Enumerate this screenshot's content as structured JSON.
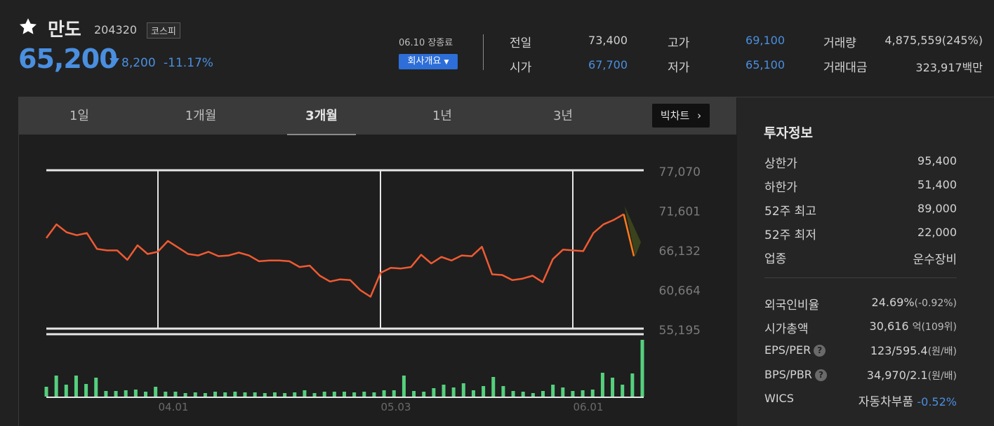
{
  "stock": {
    "name": "만도",
    "code": "204320",
    "market": "코스피",
    "price": "65,200",
    "change": "8,200",
    "change_pct": "-11.17%",
    "closed_label": "06.10 장종료",
    "company_button": "회사개요"
  },
  "summary": {
    "prev_label": "전일",
    "prev": "73,400",
    "open_label": "시가",
    "open": "67,700",
    "high_label": "고가",
    "high": "69,100",
    "low_label": "저가",
    "low": "65,100",
    "volume_label": "거래량",
    "volume": "4,875,559(245%)",
    "amount_label": "거래대금",
    "amount": "323,917백만"
  },
  "tabs": [
    "1일",
    "1개월",
    "3개월",
    "1년",
    "3년"
  ],
  "active_tab": "3개월",
  "big_chart_label": "빅차트",
  "chart_data": {
    "type": "line",
    "y_ticks": [
      "77,070",
      "71,601",
      "66,132",
      "60,664",
      "55,195"
    ],
    "x_ticks": [
      "04.01",
      "05.03",
      "06.01"
    ],
    "ylim": [
      55195,
      77070
    ],
    "series": [
      {
        "values": [
          67700,
          69600,
          68500,
          68100,
          68400,
          66200,
          66000,
          66000,
          64700,
          66700,
          65500,
          65800,
          67300,
          66400,
          65500,
          65300,
          65800,
          65200,
          65300,
          65700,
          65300,
          64500,
          64600,
          64600,
          64500,
          63700,
          63900,
          62500,
          61700,
          62000,
          61900,
          60500,
          59600,
          62900,
          63600,
          63500,
          63700,
          65400,
          64200,
          65100,
          64600,
          65300,
          65200,
          66500,
          62700,
          62600,
          61900,
          62100,
          62500,
          61600,
          64800,
          66100,
          66000,
          65900,
          68400,
          69600,
          70200,
          71000,
          65200
        ],
        "volumes": [
          14,
          30,
          17,
          30,
          18,
          27,
          8,
          8,
          9,
          10,
          7,
          14,
          7,
          7,
          5,
          6,
          5,
          7,
          6,
          7,
          6,
          6,
          5,
          6,
          5,
          6,
          9,
          5,
          7,
          7,
          7,
          6,
          7,
          6,
          9,
          9,
          30,
          8,
          7,
          12,
          17,
          13,
          19,
          9,
          15,
          28,
          15,
          8,
          7,
          5,
          8,
          17,
          13,
          8,
          9,
          10,
          34,
          27,
          17,
          33,
          81
        ],
        "color": "#f05a32"
      }
    ]
  },
  "invest": {
    "title": "투자정보",
    "rows": [
      {
        "label": "상한가",
        "value": "95,400"
      },
      {
        "label": "하한가",
        "value": "51,400"
      },
      {
        "label": "52주 최고",
        "value": "89,000"
      },
      {
        "label": "52주 최저",
        "value": "22,000"
      },
      {
        "label": "업종",
        "value": "운수장비"
      }
    ],
    "foreign_label": "외국인비율",
    "foreign": "24.69%",
    "foreign_chg": "(-0.92%)",
    "cap_label": "시가총액",
    "cap": "30,616",
    "cap_unit": "억(109위)",
    "eps_label": "EPS/PER",
    "eps": "123/595.4",
    "eps_unit": "(원/배)",
    "bps_label": "BPS/PBR",
    "bps": "34,970/2.1",
    "bps_unit": "(원/배)",
    "wics_label": "WICS",
    "wics": "자동차부품",
    "wics_chg": "-0.52%",
    "help_icon": "?"
  },
  "colors": {
    "up": "#f04a4a",
    "down": "#4a8fe0",
    "line": "#f05a32",
    "volume": "#55d07e"
  },
  "icons": {
    "favorite": "star-icon",
    "dropdown": "caret-down-icon",
    "more": "chevron-right-icon",
    "help": "question-icon"
  }
}
